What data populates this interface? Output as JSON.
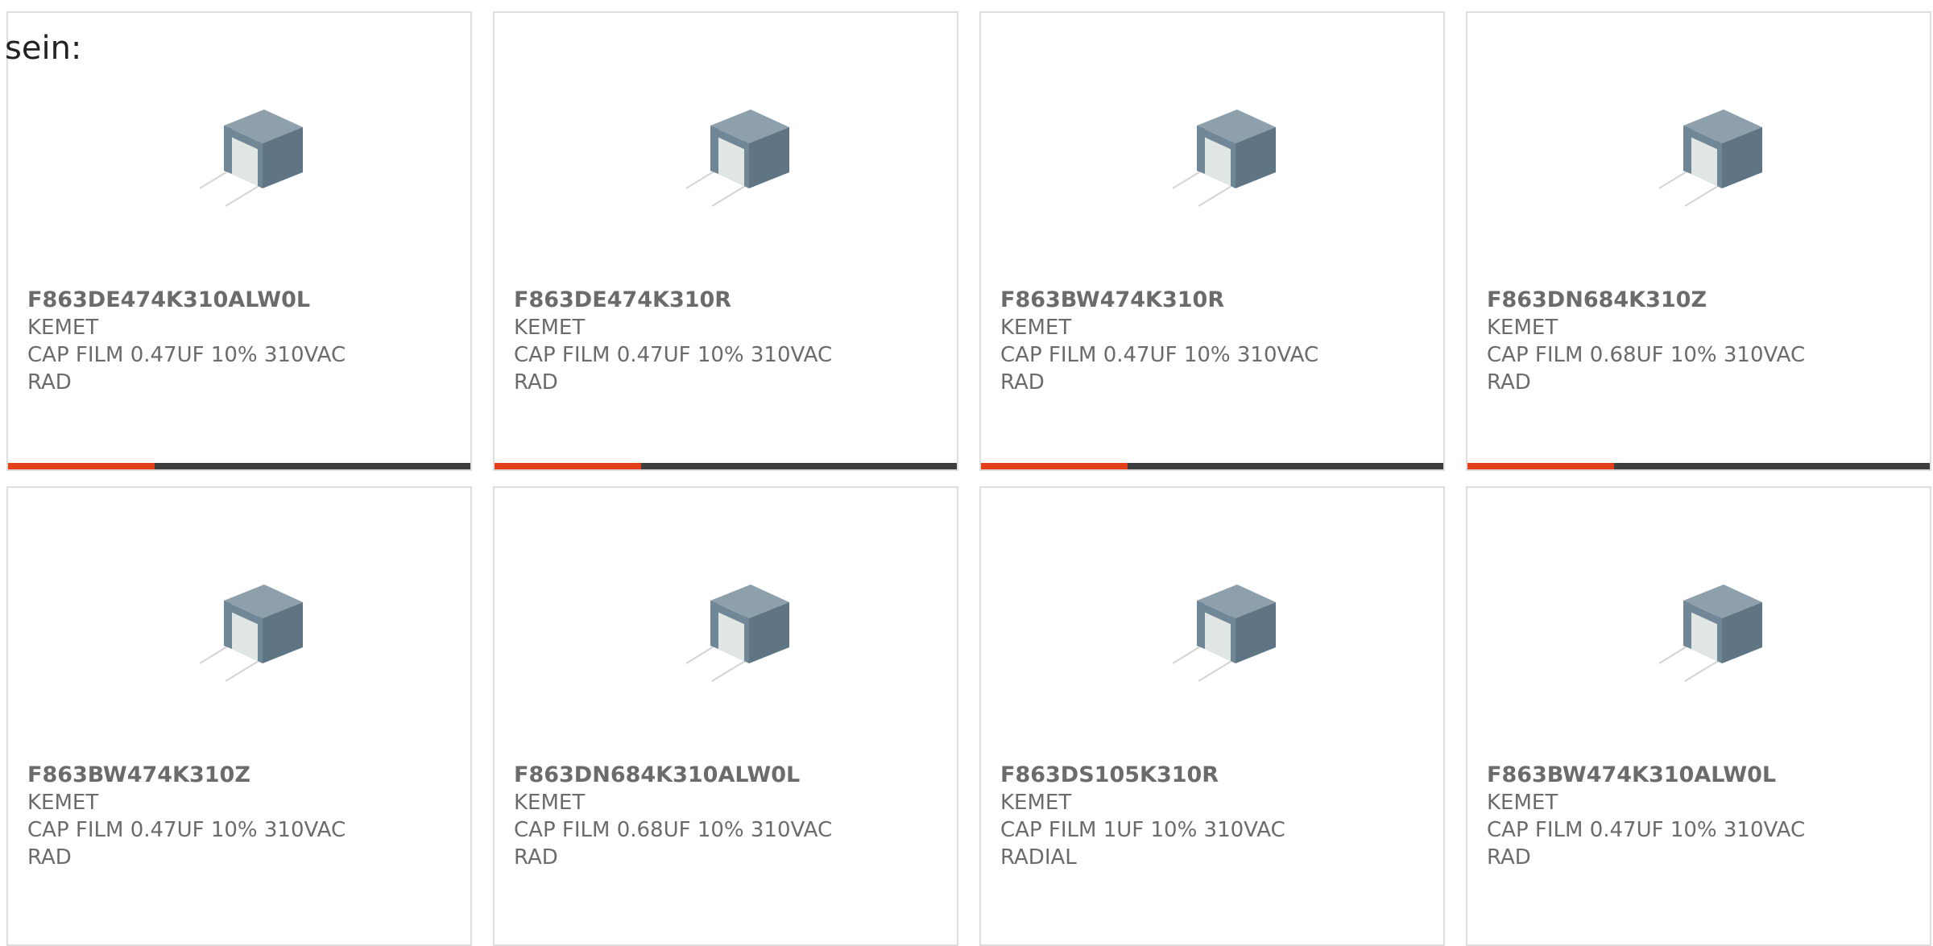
{
  "intro_text": "sein:",
  "colors": {
    "accent": "#e3401a",
    "bar_dark": "#3d3d3d",
    "text": "#6b6b6b",
    "border": "#dedede",
    "capacitor_body": "#6f8796"
  },
  "products": [
    {
      "part": "F863DE474K310ALW0L",
      "maker": "KEMET",
      "desc": "CAP FILM 0.47UF 10% 310VAC",
      "pkg": "RAD",
      "image_icon": "capacitor-image"
    },
    {
      "part": "F863DE474K310R",
      "maker": "KEMET",
      "desc": "CAP FILM 0.47UF 10% 310VAC",
      "pkg": "RAD",
      "image_icon": "capacitor-image"
    },
    {
      "part": "F863BW474K310R",
      "maker": "KEMET",
      "desc": "CAP FILM 0.47UF 10% 310VAC",
      "pkg": "RAD",
      "image_icon": "capacitor-image"
    },
    {
      "part": "F863DN684K310Z",
      "maker": "KEMET",
      "desc": "CAP FILM 0.68UF 10% 310VAC",
      "pkg": "RAD",
      "image_icon": "capacitor-image"
    },
    {
      "part": "F863BW474K310Z",
      "maker": "KEMET",
      "desc": "CAP FILM 0.47UF 10% 310VAC",
      "pkg": "RAD",
      "image_icon": "capacitor-image"
    },
    {
      "part": "F863DN684K310ALW0L",
      "maker": "KEMET",
      "desc": "CAP FILM 0.68UF 10% 310VAC",
      "pkg": "RAD",
      "image_icon": "capacitor-image"
    },
    {
      "part": "F863DS105K310R",
      "maker": "KEMET",
      "desc": "CAP FILM 1UF 10% 310VAC",
      "pkg": "RADIAL",
      "image_icon": "capacitor-image"
    },
    {
      "part": "F863BW474K310ALW0L",
      "maker": "KEMET",
      "desc": "CAP FILM 0.47UF 10% 310VAC",
      "pkg": "RAD",
      "image_icon": "capacitor-image"
    }
  ]
}
